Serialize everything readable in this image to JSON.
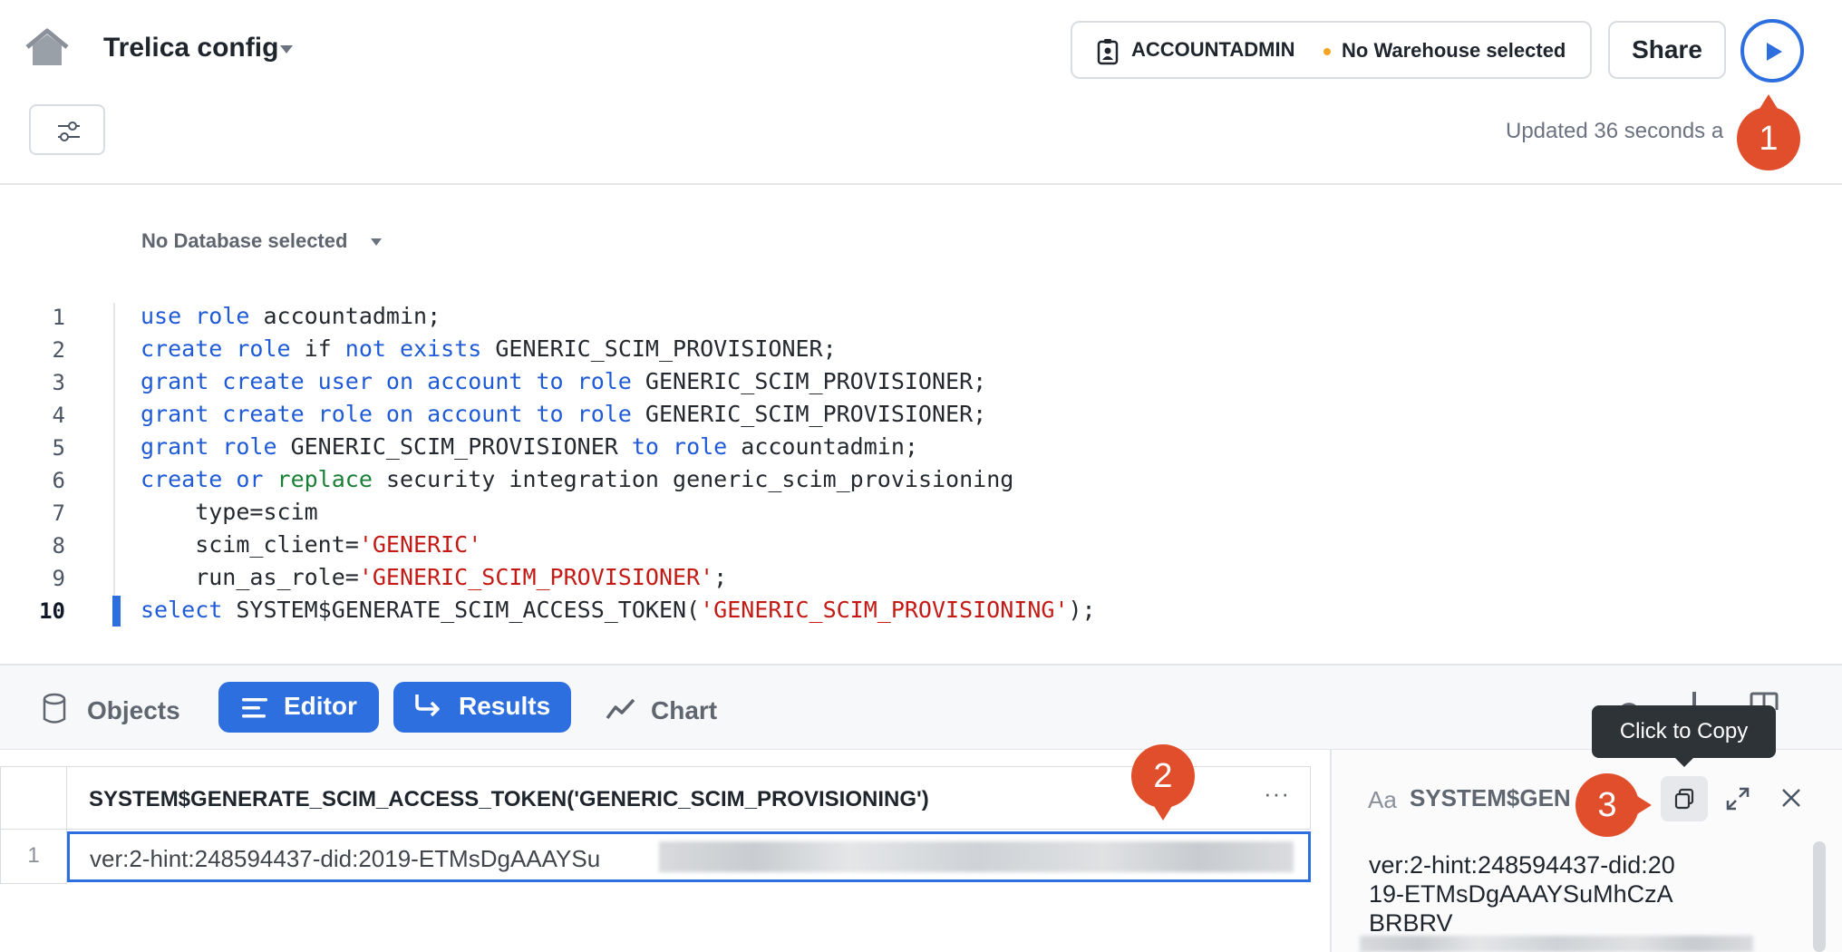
{
  "header": {
    "title": "Trelica config",
    "role": "ACCOUNTADMIN",
    "warehouse": "No Warehouse selected",
    "share_label": "Share",
    "updated_text": "Updated 36 seconds a"
  },
  "editor": {
    "database": "No Database selected",
    "line_numbers": [
      "1",
      "2",
      "3",
      "4",
      "5",
      "6",
      "7",
      "8",
      "9",
      "10"
    ],
    "active_line": 10
  },
  "tabs": {
    "objects": "Objects",
    "editor": "Editor",
    "results": "Results",
    "chart": "Chart"
  },
  "results": {
    "column_header": "SYSTEM$GENERATE_SCIM_ACCESS_TOKEN('GENERIC_SCIM_PROVISIONING')",
    "column_menu": "···",
    "row_number": "1",
    "cell_value_visible": "ver:2-hint:248594437-did:2019-ETMsDgAAAYSu"
  },
  "detail_panel": {
    "aa_label": "Aa",
    "title": "SYSTEM$GEN",
    "value_visible": "ver:2-hint:248594437-did:2019-ETMsDgAAAYSuMhCzABRBRV",
    "tooltip": "Click to Copy"
  },
  "markers": [
    "1",
    "2",
    "3"
  ],
  "colors": {
    "accent": "#2e6fe0",
    "marker": "#e04e2b",
    "keyword": "#1f5bd6",
    "string": "#c41a16",
    "warning_dot": "#f5a623"
  }
}
